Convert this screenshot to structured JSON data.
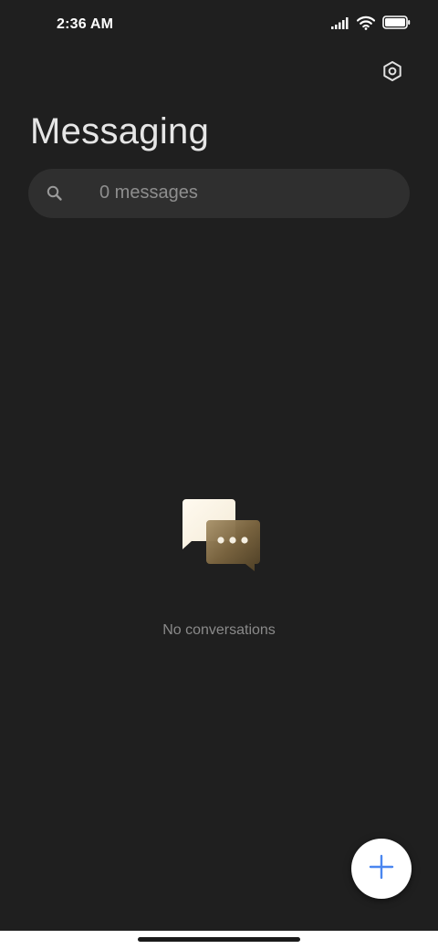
{
  "status_bar": {
    "time": "2:36 AM",
    "icons": [
      "signal-icon",
      "wifi-icon",
      "battery-icon"
    ],
    "battery_level": 1.0
  },
  "header": {
    "title": "Messaging",
    "settings_icon": "settings-icon"
  },
  "search": {
    "placeholder": "0 messages",
    "icon": "search-icon"
  },
  "empty_state": {
    "icon": "chat-bubbles-icon",
    "text": "No conversations"
  },
  "fab": {
    "icon": "plus-icon",
    "accent_color": "#4a86f0"
  },
  "colors": {
    "background": "#1f1f1f",
    "search_background": "#2f2f2f",
    "fab_background": "#ffffff"
  }
}
